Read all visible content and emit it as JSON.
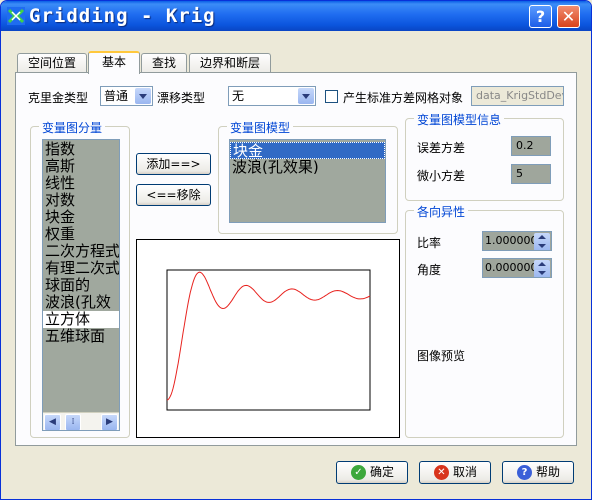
{
  "window": {
    "title": "Gridding - Krig"
  },
  "titlebar": {
    "help_label": "?",
    "close_label": "✕"
  },
  "tabs": [
    {
      "label": "空间位置"
    },
    {
      "label": "基本"
    },
    {
      "label": "查找"
    },
    {
      "label": "边界和断层"
    }
  ],
  "basic": {
    "krig_type_label": "克里金类型",
    "krig_type_value": "普通",
    "drift_type_label": "漂移类型",
    "drift_type_value": "无",
    "std_grid_label": "产生标准方差网格对象",
    "std_grid_checked": false,
    "std_grid_name": "data_KrigStdDev"
  },
  "variogram_components": {
    "title": "变量图分量",
    "items": [
      "指数",
      "高斯",
      "线性",
      "对数",
      "块金",
      "权重",
      "二次方程式",
      "有理二次式",
      "球面的",
      "波浪(孔效",
      "立方体",
      "五维球面"
    ],
    "selected_index": 10
  },
  "buttons": {
    "add_label": "添加==>",
    "remove_label": "<==移除"
  },
  "variogram_model": {
    "title": "变量图模型",
    "items": [
      "块金",
      "波浪(孔效果)"
    ],
    "selected_index": 0
  },
  "model_info": {
    "title": "变量图模型信息",
    "error_variance_label": "误差方差",
    "error_variance_value": "0.2",
    "micro_variance_label": "微小方差",
    "micro_variance_value": "5"
  },
  "anisotropy": {
    "title": "各向异性",
    "ratio_label": "比率",
    "ratio_value": "1.000000",
    "angle_label": "角度",
    "angle_value": "0.000000"
  },
  "preview": {
    "label": "图像预览",
    "curve_color": "#e8231f"
  },
  "footer": {
    "ok_label": "确定",
    "cancel_label": "取消",
    "help_label": "帮助"
  },
  "colors": {
    "title_blue": "#0a55dd",
    "group_title": "#0046d5",
    "list_grey": "#a0a89e",
    "selection_blue": "#316ac5"
  }
}
